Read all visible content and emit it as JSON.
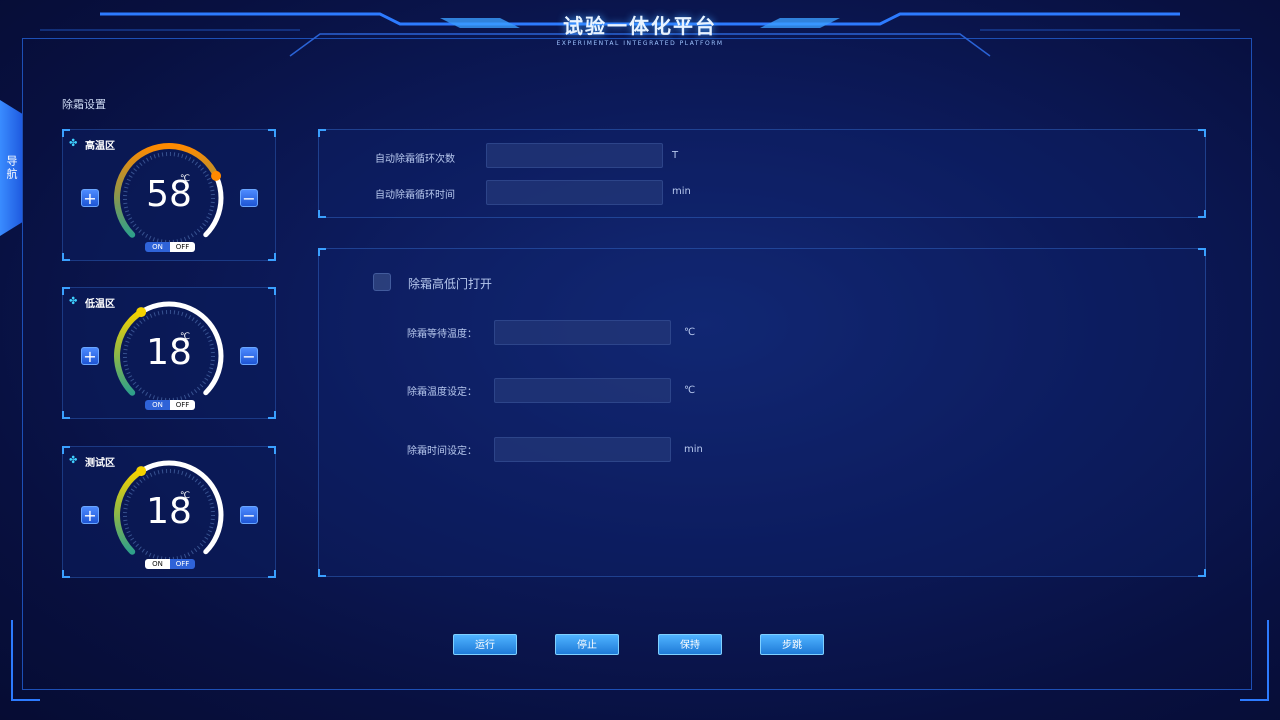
{
  "header": {
    "title": "试验一体化平台",
    "subtitle": "EXPERIMENTAL INTEGRATED PLATFORM"
  },
  "nav": {
    "label": "导航"
  },
  "section": {
    "title": "除霜设置"
  },
  "zones": [
    {
      "label": "高温区",
      "value": "58",
      "unit": "℃",
      "level": 0.74,
      "arc_color": "#ff8a00",
      "switch_on": "ON",
      "switch_off": "OFF",
      "active": "on"
    },
    {
      "label": "低温区",
      "value": "18",
      "unit": "℃",
      "level": 0.38,
      "arc_color": "#f5d200",
      "switch_on": "ON",
      "switch_off": "OFF",
      "active": "on"
    },
    {
      "label": "测试区",
      "value": "18",
      "unit": "℃",
      "level": 0.38,
      "arc_color": "#f5d200",
      "switch_on": "ON",
      "switch_off": "OFF",
      "active": "off"
    }
  ],
  "zone_buttons": {
    "plus": "+",
    "minus": "−"
  },
  "auto": {
    "count_label": "自动除霜循环次数",
    "count_value": "",
    "count_unit": "T",
    "time_label": "自动除霜循环时间",
    "time_value": "",
    "time_unit": "min"
  },
  "defrost": {
    "door_label": "除霜高低门打开",
    "wait_label": "除霜等待温度：",
    "wait_value": "",
    "wait_unit": "℃",
    "temp_label": "除霜温度设定：",
    "temp_value": "",
    "temp_unit": "℃",
    "time_label": "除霜时间设定：",
    "time_value": "",
    "time_unit": "min"
  },
  "actions": {
    "run": "运行",
    "stop": "停止",
    "hold": "保持",
    "step": "步跳"
  },
  "colors": {
    "accent": "#3aa0ff",
    "button": "#2f8ee8"
  }
}
